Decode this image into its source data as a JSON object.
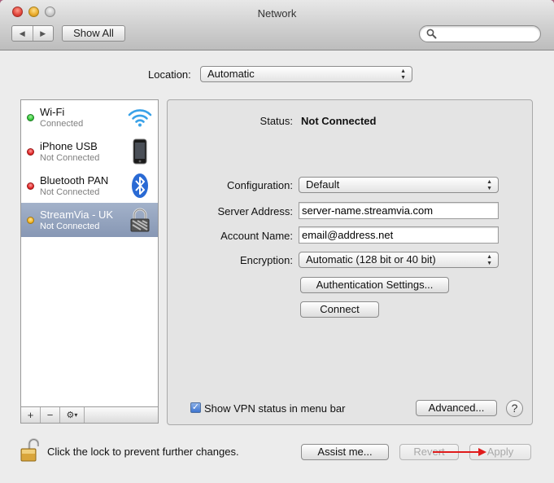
{
  "window": {
    "title": "Network"
  },
  "toolbar": {
    "back_icon": "chevron-left-icon",
    "forward_icon": "chevron-right-icon",
    "show_all_label": "Show All",
    "search_value": ""
  },
  "location": {
    "label": "Location:",
    "value": "Automatic"
  },
  "services": [
    {
      "name": "Wi-Fi",
      "status": "Connected",
      "status_color": "#2fc234",
      "icon": "wifi-icon",
      "selected": false
    },
    {
      "name": "iPhone USB",
      "status": "Not Connected",
      "status_color": "#e02020",
      "icon": "iphone-icon",
      "selected": false
    },
    {
      "name": "Bluetooth PAN",
      "status": "Not Connected",
      "status_color": "#e02020",
      "icon": "bluetooth-icon",
      "selected": false
    },
    {
      "name": "StreamVia - UK",
      "status": "Not Connected",
      "status_color": "#f2b41e",
      "icon": "vpn-lock-icon",
      "selected": true
    }
  ],
  "sidebar_controls": {
    "add_label": "+",
    "remove_label": "−",
    "gear_icon": "gear-icon",
    "gear_menu_label": "▾"
  },
  "detail": {
    "status_label": "Status:",
    "status_value": "Not Connected",
    "configuration_label": "Configuration:",
    "configuration_value": "Default",
    "server_address_label": "Server Address:",
    "server_address_value": "server-name.streamvia.com",
    "account_name_label": "Account Name:",
    "account_name_value": "email@address.net",
    "encryption_label": "Encryption:",
    "encryption_value": "Automatic (128 bit or 40 bit)",
    "auth_settings_label": "Authentication Settings...",
    "connect_label": "Connect",
    "show_vpn_status_label": "Show VPN status in menu bar",
    "show_vpn_status_checked": true,
    "advanced_label": "Advanced...",
    "help_label": "?"
  },
  "footer": {
    "lock_text": "Click the lock to prevent further changes.",
    "assist_label": "Assist me...",
    "revert_label": "Revert",
    "apply_label": "Apply"
  },
  "colors": {
    "selection": "#8b9bb8",
    "annotation_arrow": "#e01b1b"
  }
}
